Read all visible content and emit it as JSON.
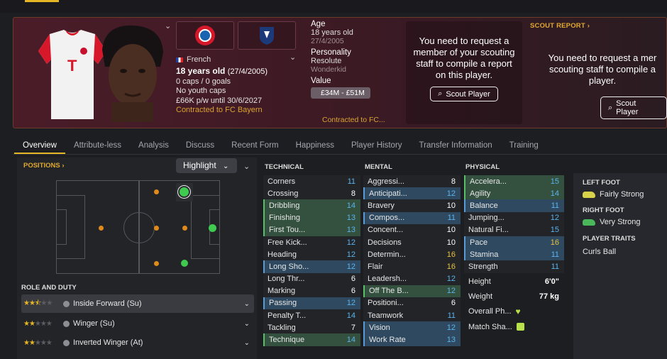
{
  "player": {
    "nationality": "French",
    "age_line": "18 years old",
    "dob_paren": "(27/4/2005)",
    "caps": "0 caps / 0 goals",
    "youth": "No youth caps",
    "wage": "£66K p/w until 30/6/2027",
    "contract": "Contracted to FC Bayern"
  },
  "summary": {
    "age_label": "Age",
    "age_value": "18 years old",
    "dob": "27/4/2005",
    "personality_label": "Personality",
    "personality_value": "Resolute",
    "personality_sub": "Wonderkid",
    "value_label": "Value",
    "value_range": "£34M - £51M",
    "contract_short": "Contracted to FC..."
  },
  "scout": {
    "message": "You need to request a member of your scouting staff to compile a report on this player.",
    "button": "Scout Player",
    "report_label": "SCOUT REPORT",
    "message2a": "You need to request a mer",
    "message2b": "scouting staff to compile a",
    "message2c": "player."
  },
  "tabs": [
    "Overview",
    "Attribute-less",
    "Analysis",
    "Discuss",
    "Recent Form",
    "Happiness",
    "Player History",
    "Transfer Information",
    "Training"
  ],
  "positions": {
    "label": "POSITIONS",
    "highlight": "Highlight"
  },
  "roles": {
    "label": "ROLE AND DUTY",
    "items": [
      {
        "name": "Inside Forward (Su)",
        "stars": 2.5
      },
      {
        "name": "Winger (Su)",
        "stars": 2
      },
      {
        "name": "Inverted Winger (At)",
        "stars": 2
      }
    ]
  },
  "attributes": {
    "technical_label": "TECHNICAL",
    "mental_label": "MENTAL",
    "physical_label": "PHYSICAL",
    "technical": [
      [
        "Corners",
        "11"
      ],
      [
        "Crossing",
        "8"
      ],
      [
        "Dribbling",
        "14"
      ],
      [
        "Finishing",
        "13"
      ],
      [
        "First Tou...",
        "13"
      ],
      [
        "Free Kick...",
        "12"
      ],
      [
        "Heading",
        "12"
      ],
      [
        "Long Sho...",
        "12"
      ],
      [
        "Long Thr...",
        "6"
      ],
      [
        "Marking",
        "6"
      ],
      [
        "Passing",
        "12"
      ],
      [
        "Penalty T...",
        "14"
      ],
      [
        "Tackling",
        "7"
      ],
      [
        "Technique",
        "14"
      ]
    ],
    "mental": [
      [
        "Aggressi...",
        "8"
      ],
      [
        "Anticipati...",
        "12"
      ],
      [
        "Bravery",
        "10"
      ],
      [
        "Compos...",
        "11"
      ],
      [
        "Concent...",
        "10"
      ],
      [
        "Decisions",
        "10"
      ],
      [
        "Determin...",
        "16"
      ],
      [
        "Flair",
        "16"
      ],
      [
        "Leadersh...",
        "12"
      ],
      [
        "Off The B...",
        "12"
      ],
      [
        "Positioni...",
        "6"
      ],
      [
        "Teamwork",
        "11"
      ],
      [
        "Vision",
        "12"
      ],
      [
        "Work Rate",
        "13"
      ]
    ],
    "physical": [
      [
        "Accelera...",
        "15"
      ],
      [
        "Agility",
        "14"
      ],
      [
        "Balance",
        "11"
      ],
      [
        "Jumping...",
        "12"
      ],
      [
        "Natural Fi...",
        "15"
      ],
      [
        "Pace",
        "16"
      ],
      [
        "Stamina",
        "11"
      ],
      [
        "Strength",
        "11"
      ]
    ],
    "height_label": "Height",
    "height": "6'0\"",
    "weight_label": "Weight",
    "weight": "77 kg",
    "overall_label": "Overall Ph...",
    "match_label": "Match Sha..."
  },
  "profile": {
    "left_foot_label": "LEFT FOOT",
    "left_foot": "Fairly Strong",
    "right_foot_label": "RIGHT FOOT",
    "right_foot": "Very Strong",
    "traits_label": "PLAYER TRAITS",
    "trait": "Curls Ball"
  }
}
